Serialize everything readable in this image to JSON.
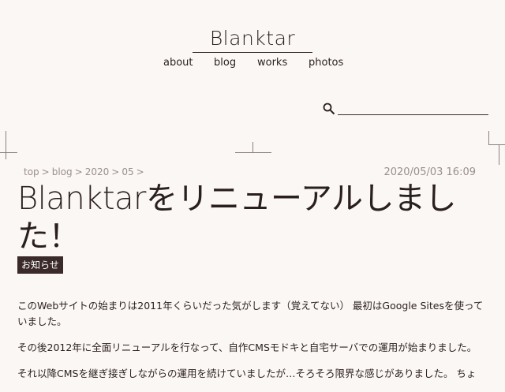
{
  "site": {
    "title": "Blanktar"
  },
  "nav": {
    "items": [
      "about",
      "blog",
      "works",
      "photos"
    ]
  },
  "search": {
    "placeholder": ""
  },
  "breadcrumb": [
    "top",
    "blog",
    "2020",
    "05"
  ],
  "breadcrumb_sep": ">",
  "post": {
    "date": "2020/05/03 16:09",
    "title": "Blanktarをリニューアルしました！",
    "tag": "お知らせ",
    "paragraphs": [
      "このWebサイトの始まりは2011年くらいだった気がします（覚えてない） 最初はGoogle Sitesを使っていました。",
      "その後2012年に全面リニューアルを行なって、自作CMSモドキと自宅サーバでの運用が始まりました。",
      "それ以降CMSを継ぎ接ぎしながらの運用を続けていましたが…そろそろ限界な感じがありました。 ちょ"
    ]
  },
  "colors": {
    "text": "#2a1f1f",
    "background": "#fbf7f4",
    "tag_bg": "#3a2a2a",
    "muted": "#9a8e8e"
  }
}
